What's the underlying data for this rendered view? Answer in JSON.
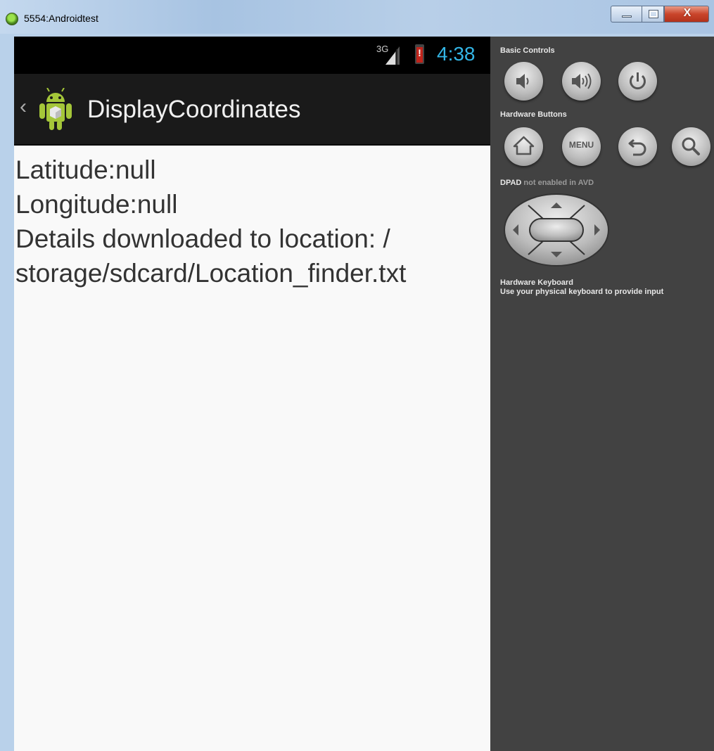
{
  "window": {
    "title": "5554:Androidtest",
    "close_glyph": "X"
  },
  "status_bar": {
    "network": "3G",
    "time": "4:38",
    "time_color": "#33b5e5"
  },
  "action_bar": {
    "up_glyph": "‹",
    "title": "DisplayCoordinates"
  },
  "content": {
    "lines": [
      "Latitude:null",
      "Longitude:null",
      "Details downloaded to location: /",
      "storage/sdcard/Location_finder.txt"
    ]
  },
  "controls_panel": {
    "basic_controls_label": "Basic Controls",
    "hardware_buttons_label": "Hardware Buttons",
    "dpad_label_strong": "DPAD",
    "dpad_label_dim": "not enabled in AVD",
    "keyboard_title": "Hardware Keyboard",
    "keyboard_hint": "Use your physical keyboard to provide input",
    "menu_label": "MENU",
    "basic_controls": [
      "volume-down-icon",
      "volume-up-icon",
      "power-icon"
    ],
    "hardware_buttons": [
      "home-icon",
      "menu-button",
      "back-icon",
      "search-icon"
    ]
  }
}
